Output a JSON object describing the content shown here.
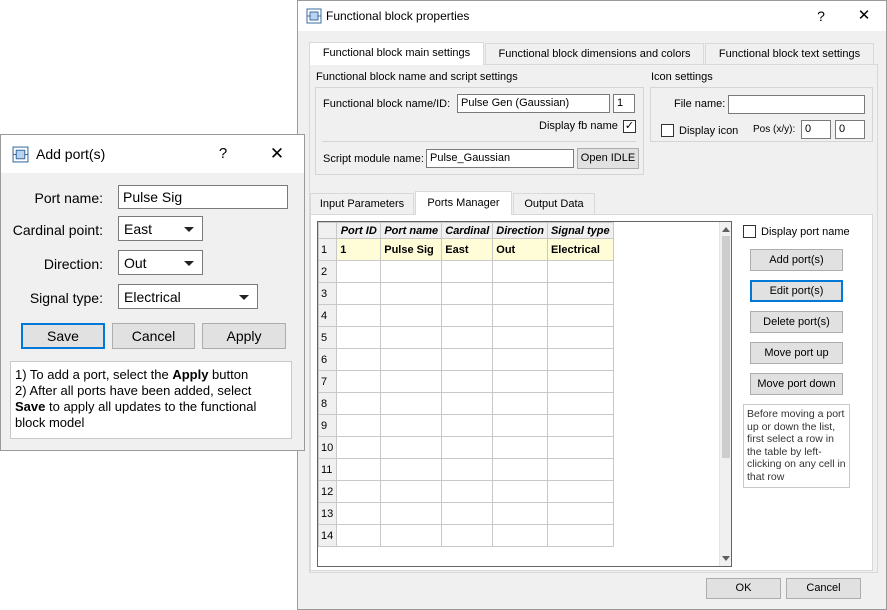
{
  "fbp": {
    "title": "Functional block properties",
    "help": "?",
    "close": "✕",
    "tabs": [
      "Functional block main settings",
      "Functional block dimensions and colors",
      "Functional block text settings"
    ],
    "name_script": {
      "heading": "Functional block name and script settings",
      "name_label": "Functional block name/ID:",
      "name_value": "Pulse Gen (Gaussian)",
      "id_value": "1",
      "display_fb_label": "Display fb name",
      "display_fb_checked": "✓",
      "script_label": "Script module name:",
      "script_value": "Pulse_Gaussian",
      "open_idle": "Open IDLE"
    },
    "icon": {
      "heading": "Icon settings",
      "file_label": "File name:",
      "file_value": "",
      "display_icon_label": "Display icon",
      "pos_label": "Pos (x/y):",
      "pos_x": "0",
      "pos_y": "0"
    },
    "subtabs": [
      "Input Parameters",
      "Ports Manager",
      "Output Data"
    ],
    "ports": {
      "columns": [
        "Port ID",
        "Port name",
        "Cardinal",
        "Direction",
        "Signal type"
      ],
      "rows": [
        [
          "1",
          "Pulse Sig",
          "East",
          "Out",
          "Electrical"
        ]
      ],
      "row_numbers": [
        "1",
        "2",
        "3",
        "4",
        "5",
        "6",
        "7",
        "8",
        "9",
        "10",
        "11",
        "12",
        "13",
        "14"
      ],
      "display_port_name": "Display port name",
      "add": "Add port(s)",
      "edit": "Edit port(s)",
      "delete": "Delete port(s)",
      "up": "Move port up",
      "down": "Move port down",
      "note": "Before moving a port up or down the list, first select a row in the table by left-clicking on any cell in that row"
    },
    "ok": "OK",
    "cancel": "Cancel"
  },
  "addport": {
    "title": "Add port(s)",
    "help": "?",
    "close": "✕",
    "port_name_label": "Port name:",
    "port_name_value": "Pulse Sig",
    "cardinal_label": "Cardinal point:",
    "cardinal_value": "East",
    "direction_label": "Direction:",
    "direction_value": "Out",
    "signal_label": "Signal type:",
    "signal_value": "Electrical",
    "save": "Save",
    "cancel": "Cancel",
    "apply": "Apply",
    "help_line1_pre": "1) To add a port, select the ",
    "help_line1_bold": "Apply",
    "help_line1_post": " button",
    "help_line2": "2) After all ports have been added, select",
    "help_line3_bold": "Save",
    "help_line3_post": " to apply all updates to the functional",
    "help_line4": "block model"
  },
  "colors": {
    "accent": "#0078d7",
    "selected_row": "#fffcd8",
    "dialog_bg": "#f0f0f0"
  }
}
